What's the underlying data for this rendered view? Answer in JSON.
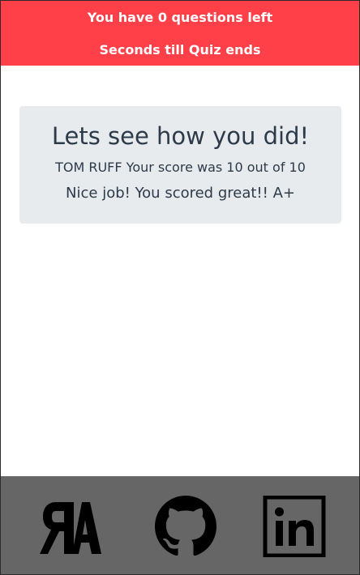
{
  "header": {
    "questions_left": "You have 0 questions left",
    "timer_text": "Seconds till Quiz ends",
    "background": "#ff4049"
  },
  "result": {
    "title": "Lets see how you did!",
    "score_text": "TOM RUFF Your score was 10 out of 10",
    "grade_text": "Nice job! You scored great!! A+"
  },
  "footer": {
    "links": [
      {
        "icon": "ra-logo-icon"
      },
      {
        "icon": "github-icon"
      },
      {
        "icon": "linkedin-icon"
      }
    ],
    "background": "#666666"
  }
}
